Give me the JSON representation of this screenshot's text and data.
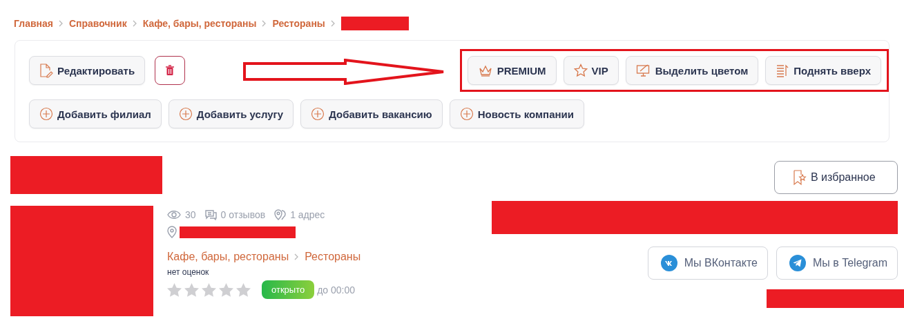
{
  "breadcrumbs": [
    {
      "label": "Главная"
    },
    {
      "label": "Справочник"
    },
    {
      "label": "Кафе, бары, рестораны"
    },
    {
      "label": "Рестораны"
    }
  ],
  "actions": {
    "edit": {
      "label": "Редактировать"
    },
    "promo": [
      {
        "kind": "crown",
        "label": "PREMIUM"
      },
      {
        "kind": "star",
        "label": "VIP"
      },
      {
        "kind": "monitor",
        "label": "Выделить цветом"
      },
      {
        "kind": "list",
        "label": "Поднять вверх"
      }
    ],
    "add": [
      {
        "label": "Добавить филиал"
      },
      {
        "label": "Добавить услугу"
      },
      {
        "label": "Добавить вакансию"
      },
      {
        "label": "Новость компании"
      }
    ]
  },
  "company": {
    "favorite": {
      "label": "В избранное"
    },
    "stats": [
      {
        "kind": "views",
        "label": "30"
      },
      {
        "kind": "reviews",
        "label": "0 отзывов"
      },
      {
        "kind": "addresses",
        "label": "1 адрес"
      }
    ],
    "categories": [
      {
        "label": "Кафе, бары, рестораны"
      },
      {
        "label": "Рестораны"
      }
    ],
    "rating_label": "нет оценок",
    "stars": 0,
    "status": {
      "label": "открыто",
      "open": true
    },
    "hours": "до 00:00",
    "social": [
      {
        "kind": "vk",
        "label": "Мы ВКонтакте"
      },
      {
        "kind": "telegram",
        "label": "Мы в Telegram"
      }
    ]
  }
}
